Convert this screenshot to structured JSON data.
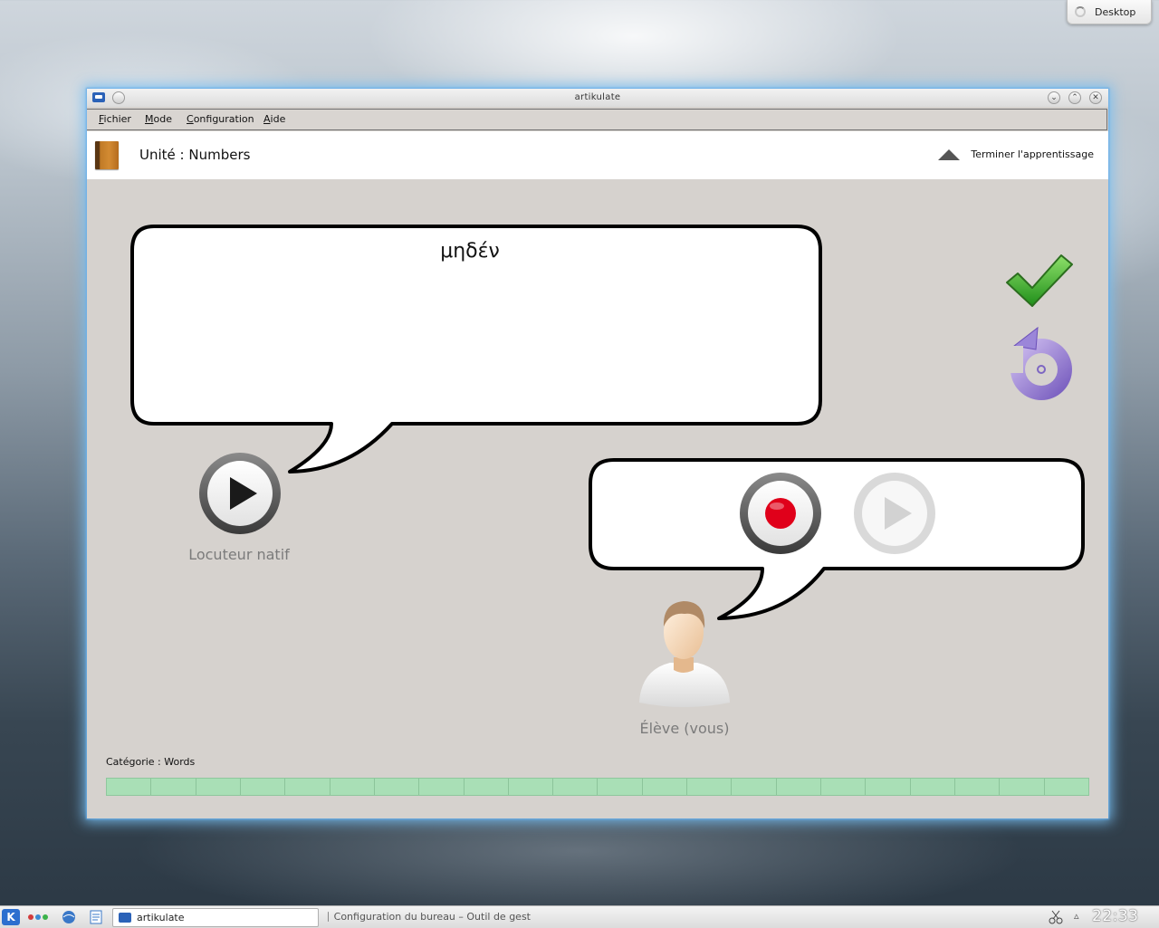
{
  "desktop": {
    "button_label": "Desktop"
  },
  "window": {
    "title": "artikulate",
    "menu": [
      "Fichier",
      "Mode",
      "Configuration",
      "Aide"
    ],
    "unit_label": "Unité : Numbers",
    "finish_label": "Terminer l'apprentissage",
    "phrase": "μηδέν",
    "native_speaker_label": "Locuteur natif",
    "student_label": "Élève (vous)",
    "category_label": "Catégorie : Words",
    "progress_segments": 22,
    "colors": {
      "progress_fill": "#a9dfb6",
      "window_glow": "#78bef0",
      "record": "#e0001a",
      "check": "#35b22a",
      "retry": "#8d73c9"
    }
  },
  "taskbar": {
    "tasks": [
      {
        "label": "artikulate",
        "active": true
      },
      {
        "label": "Configuration du bureau – Outil de gest",
        "active": false
      }
    ],
    "clock": "22:33",
    "icons": [
      "kde-menu-icon",
      "activity-dots-icon",
      "network-icon",
      "document-icon",
      "scissors-icon",
      "tray-arrow-icon"
    ]
  }
}
